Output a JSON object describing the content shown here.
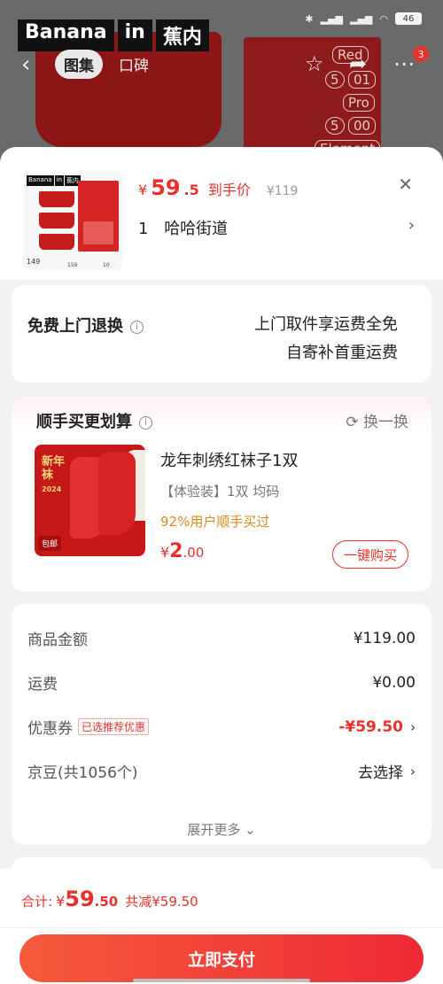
{
  "background": {
    "brand_parts": [
      "Banana",
      "in",
      "蕉内"
    ],
    "tabs": [
      "图集",
      "口碑"
    ],
    "box_tags": [
      "Red",
      "5",
      "01",
      "Pro",
      "5",
      "00",
      "Element"
    ],
    "cart_badge": "3",
    "battery": "46"
  },
  "product": {
    "currency": "¥",
    "price_int": "59",
    "price_dec": ".5",
    "price_label": "到手价",
    "original_price": "¥119",
    "quantity": "1",
    "spec": "哈哈街道",
    "thumb": {
      "logo": [
        "Banana",
        "in",
        "蕉内"
      ],
      "price": "149",
      "sub_prices": [
        "159",
        "10"
      ]
    }
  },
  "return_service": {
    "title": "免费上门退换",
    "line1": "上门取件享运费全免",
    "line2": "自寄补首重运费"
  },
  "addon": {
    "title": "顺手买更划算",
    "swap_label": "换一换",
    "name": "龙年刺绣红袜子1双",
    "spec": "【体验装】1双   均码",
    "purchase_rate": "92%用户顺手买过",
    "currency": "¥",
    "price_int": "2",
    "price_dec": ".00",
    "buy_label": "一键购买",
    "image_text": {
      "year_text": "新年袜",
      "year": "2024",
      "package": "包邮"
    }
  },
  "summary": {
    "items": [
      {
        "label": "商品金额",
        "value": "¥119.00"
      },
      {
        "label": "运费",
        "value": "¥0.00"
      },
      {
        "label": "优惠券",
        "tag": "已选推荐优惠",
        "value": "-¥59.50"
      },
      {
        "label": "京豆(共1056个)",
        "value": "去选择"
      }
    ],
    "expand_label": "展开更多"
  },
  "footer": {
    "total_label": "合计:",
    "currency": "¥",
    "total_int": "59",
    "total_dec": ".50",
    "saved": "共减¥59.50",
    "pay_label": "立即支付"
  },
  "colors": {
    "accent": "#e9302b",
    "addon_rate": "#d98c1e"
  }
}
